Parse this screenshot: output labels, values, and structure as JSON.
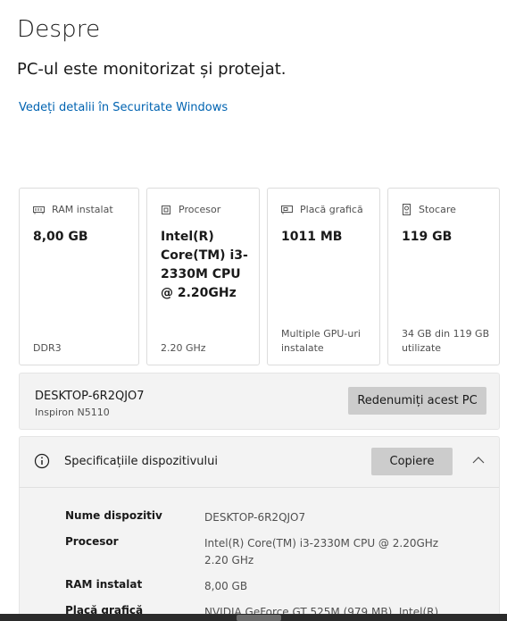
{
  "header": {
    "title": "Despre",
    "status": "PC-ul este monitorizat și protejat.",
    "link": "Vedeți detalii în Securitate Windows"
  },
  "cards": [
    {
      "label": "RAM instalat",
      "value": "8,00 GB",
      "footer": "DDR3",
      "icon": "ram-icon"
    },
    {
      "label": "Procesor",
      "value": "Intel(R) Core(TM) i3-2330M CPU @ 2.20GHz",
      "footer": "2.20 GHz",
      "icon": "processor-icon"
    },
    {
      "label": "Placă grafică",
      "value": "1011 MB",
      "footer": "Multiple GPU-uri instalate",
      "icon": "graphics-card-icon"
    },
    {
      "label": "Stocare",
      "value": "119 GB",
      "footer": "34 GB din 119 GB utilizate",
      "icon": "storage-icon"
    }
  ],
  "pc": {
    "name": "DESKTOP-6R2QJO7",
    "model": "Inspiron N5110",
    "rename_label": "Redenumiți acest PC"
  },
  "specs": {
    "title": "Specificațiile dispozitivului",
    "copy_label": "Copiere",
    "rows": [
      {
        "key": "Nume dispozitiv",
        "value": "DESKTOP-6R2QJO7"
      },
      {
        "key": "Procesor",
        "value": "Intel(R) Core(TM) i3-2330M CPU @ 2.20GHz 2.20 GHz"
      },
      {
        "key": "RAM instalat",
        "value": "8,00 GB"
      },
      {
        "key": "Placă grafică",
        "value": "NVIDIA GeForce GT 525M (979 MB), Intel(R)"
      }
    ]
  },
  "colors": {
    "link": "#0063b1",
    "button": "#cccccc",
    "panel": "#f3f3f3"
  }
}
